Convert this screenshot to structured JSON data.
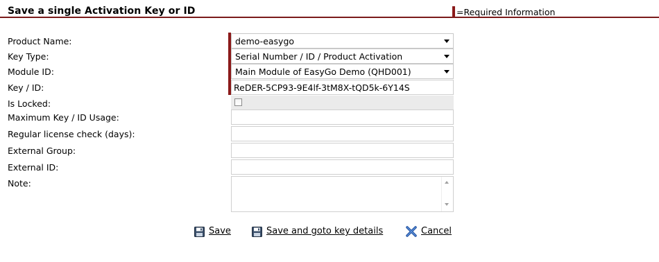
{
  "header": {
    "title": "Save a single Activation Key or ID",
    "required_info": "=Required Information"
  },
  "form": {
    "product_name": {
      "label": "Product Name:",
      "value": "demo-easygo"
    },
    "key_type": {
      "label": "Key Type:",
      "value": "Serial Number / ID / Product Activation"
    },
    "module_id": {
      "label": "Module ID:",
      "value": "Main Module of EasyGo Demo (QHD001)"
    },
    "key_id": {
      "label": "Key / ID:",
      "value": "ReDER-5CP93-9E4lf-3tM8X-tQD5k-6Y14S"
    },
    "is_locked": {
      "label": "Is Locked:",
      "checked": false
    },
    "max_usage": {
      "label": "Maximum Key / ID Usage:",
      "value": ""
    },
    "license_check": {
      "label": "Regular license check (days):",
      "value": ""
    },
    "external_group": {
      "label": "External Group:",
      "value": ""
    },
    "external_id": {
      "label": "External ID:",
      "value": ""
    },
    "note": {
      "label": "Note:",
      "value": ""
    }
  },
  "actions": {
    "save": "Save",
    "save_goto": "Save and goto key details",
    "cancel": "Cancel"
  },
  "colors": {
    "accent": "#8b1a1a",
    "header_rule": "#7a1a1a",
    "cancel_icon": "#2a5fb5"
  },
  "icons": {
    "save": "floppy-disk-icon",
    "cancel": "x-cross-icon"
  }
}
